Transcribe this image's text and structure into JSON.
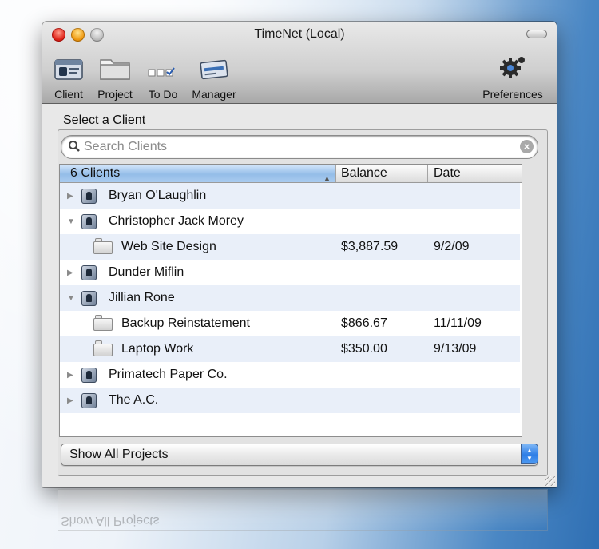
{
  "window": {
    "title": "TimeNet (Local)"
  },
  "toolbar": {
    "client_label": "Client",
    "project_label": "Project",
    "todo_label": "To Do",
    "manager_label": "Manager",
    "preferences_label": "Preferences"
  },
  "main": {
    "section_label": "Select a Client",
    "search": {
      "placeholder": "Search Clients"
    },
    "table": {
      "headers": {
        "name": "6 Clients",
        "balance": "Balance",
        "date": "Date"
      },
      "rows": [
        {
          "type": "client",
          "expanded": false,
          "name": "Bryan O'Laughlin",
          "balance": "",
          "date": ""
        },
        {
          "type": "client",
          "expanded": true,
          "name": "Christopher Jack Morey",
          "balance": "",
          "date": ""
        },
        {
          "type": "project",
          "name": "Web Site Design",
          "balance": "$3,887.59",
          "date": "9/2/09"
        },
        {
          "type": "client",
          "expanded": false,
          "name": "Dunder Miflin",
          "balance": "",
          "date": ""
        },
        {
          "type": "client",
          "expanded": true,
          "name": "Jillian Rone",
          "balance": "",
          "date": ""
        },
        {
          "type": "project",
          "name": "Backup Reinstatement",
          "balance": "$866.67",
          "date": "11/11/09"
        },
        {
          "type": "project",
          "name": "Laptop Work",
          "balance": "$350.00",
          "date": "9/13/09"
        },
        {
          "type": "client",
          "expanded": false,
          "name": "Primatech Paper Co.",
          "balance": "",
          "date": ""
        },
        {
          "type": "client",
          "expanded": false,
          "name": "The A.C.",
          "balance": "",
          "date": ""
        }
      ]
    },
    "filter": {
      "selected": "Show All Projects"
    }
  },
  "reflection": {
    "text": "Show All Projects"
  }
}
